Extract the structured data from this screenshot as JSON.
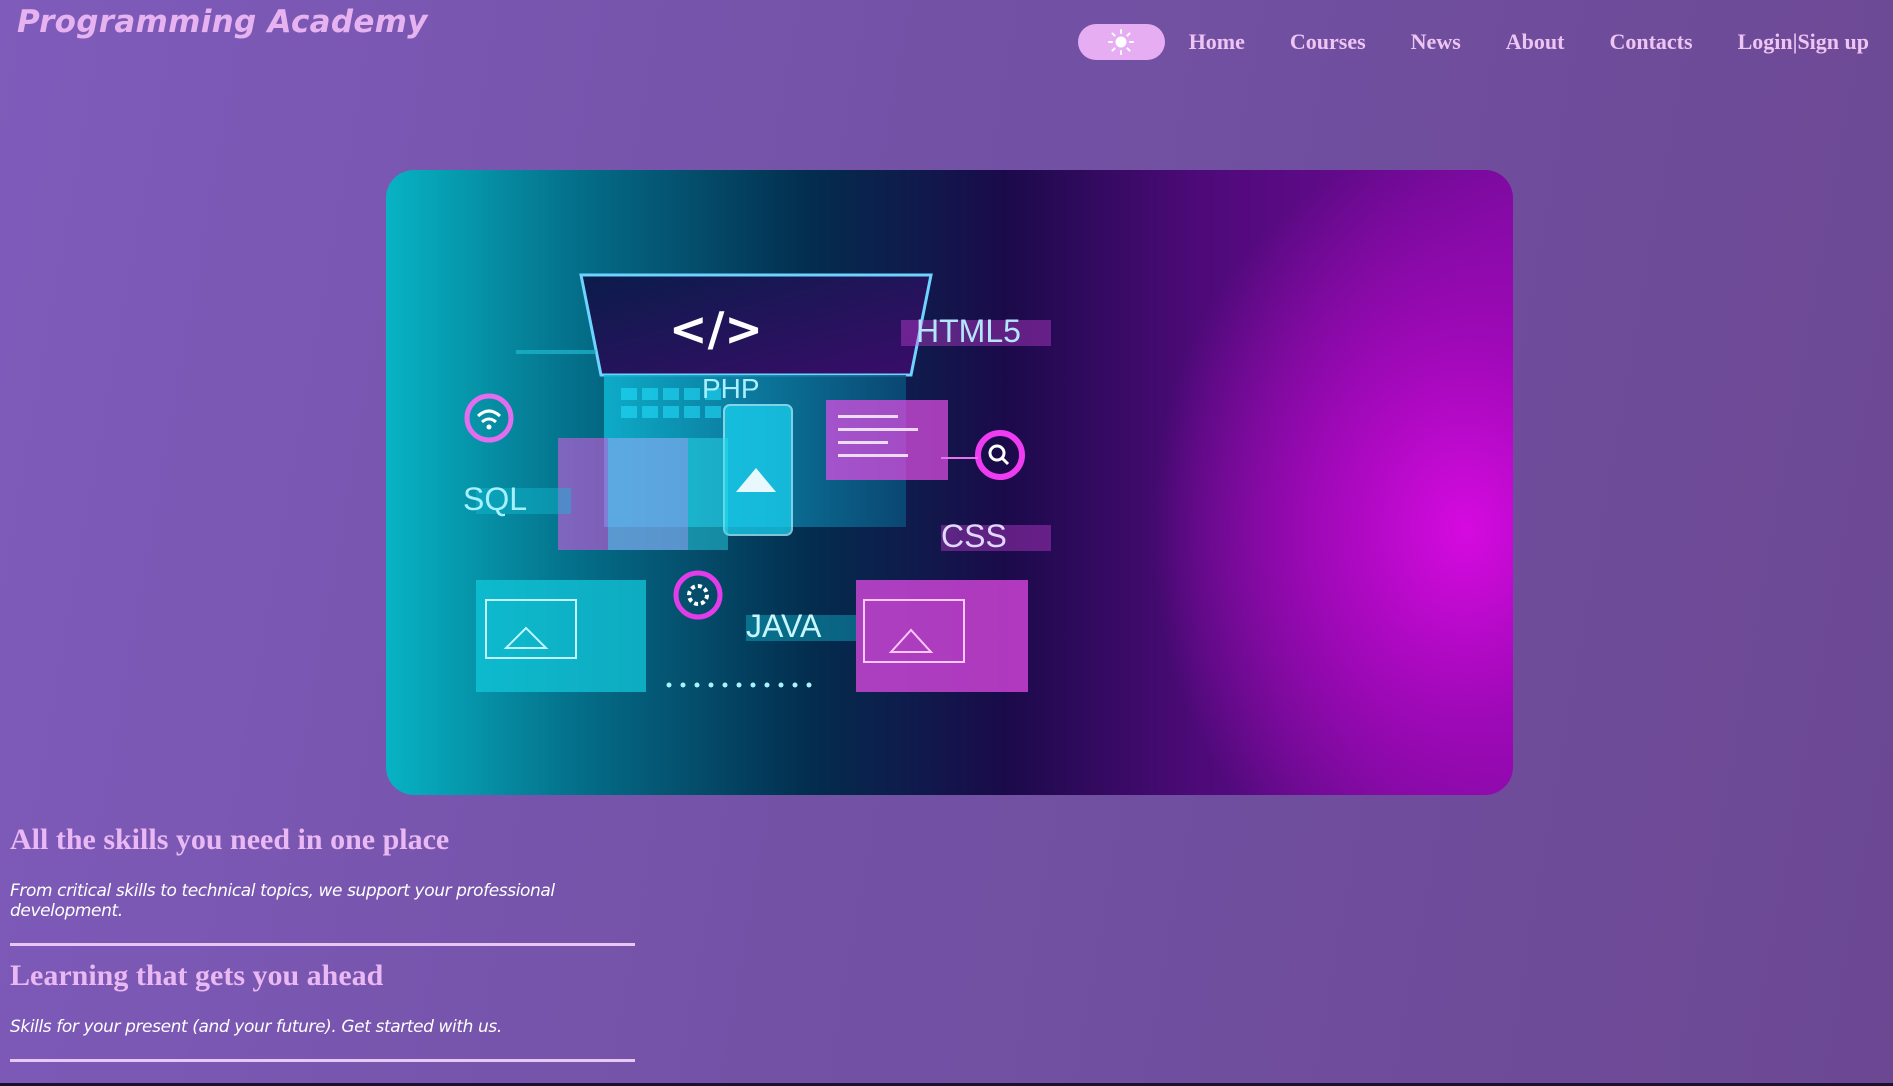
{
  "brand": {
    "title": "Programming Academy"
  },
  "nav": {
    "theme_icon": "sun-icon",
    "links": [
      "Home",
      "Courses",
      "News",
      "About",
      "Contacts",
      "Login|Sign up"
    ]
  },
  "hero": {
    "image_labels": {
      "code": "</>",
      "html": "HTML5",
      "php": "PHP",
      "sql": "SQL",
      "css": "CSS",
      "java": "JAVA"
    }
  },
  "sections": [
    {
      "heading": "All the skills you need in one place",
      "text": "From critical skills to technical topics, we support your professional development."
    },
    {
      "heading": "Learning that gets you ahead",
      "text": "Skills for your present (and your future). Get started with us."
    }
  ],
  "colors": {
    "background": "#7352a6",
    "brand_text": "#e6b3f0",
    "nav_text": "#eec4f3",
    "toggle_bg": "#e6adf2",
    "cyan": "#16d6e6",
    "magenta": "#e23cf0"
  }
}
